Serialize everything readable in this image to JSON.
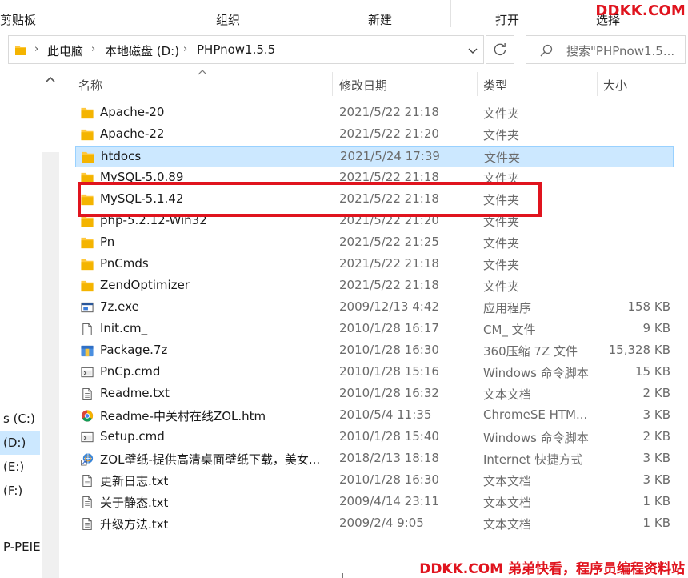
{
  "ribbon": {
    "groups": [
      "剪贴板",
      "组织",
      "新建",
      "打开",
      "选择"
    ]
  },
  "watermark_top": "DDKK.COM",
  "address": {
    "crumbs": [
      "此电脑",
      "本地磁盘 (D:)",
      "PHPnow1.5.5"
    ]
  },
  "search": {
    "placeholder": "搜索\"PHPnow1.5..."
  },
  "nav": {
    "items": [
      {
        "label": "s (C:)",
        "selected": false
      },
      {
        "label": "(D:)",
        "selected": true
      },
      {
        "label": "(E:)",
        "selected": false
      },
      {
        "label": "(F:)",
        "selected": false
      },
      {
        "label": "P-PEIEL",
        "selected": false
      }
    ]
  },
  "columns": {
    "name": "名称",
    "date": "修改日期",
    "type": "类型",
    "size": "大小"
  },
  "files": [
    {
      "icon": "folder-icon",
      "name": "Apache-20",
      "date": "2021/5/22 21:18",
      "type": "文件夹",
      "size": ""
    },
    {
      "icon": "folder-icon",
      "name": "Apache-22",
      "date": "2021/5/22 21:20",
      "type": "文件夹",
      "size": ""
    },
    {
      "icon": "folder-icon",
      "name": "htdocs",
      "date": "2021/5/24 17:39",
      "type": "文件夹",
      "size": "",
      "selected": true
    },
    {
      "icon": "folder-icon",
      "name": "MySQL-5.0.89",
      "date": "2021/5/22 21:18",
      "type": "文件夹",
      "size": ""
    },
    {
      "icon": "folder-icon",
      "name": "MySQL-5.1.42",
      "date": "2021/5/22 21:18",
      "type": "文件夹",
      "size": ""
    },
    {
      "icon": "folder-icon",
      "name": "php-5.2.12-Win32",
      "date": "2021/5/22 21:20",
      "type": "文件夹",
      "size": ""
    },
    {
      "icon": "folder-icon",
      "name": "Pn",
      "date": "2021/5/22 21:25",
      "type": "文件夹",
      "size": ""
    },
    {
      "icon": "folder-icon",
      "name": "PnCmds",
      "date": "2021/5/22 21:18",
      "type": "文件夹",
      "size": ""
    },
    {
      "icon": "folder-icon",
      "name": "ZendOptimizer",
      "date": "2021/5/22 21:18",
      "type": "文件夹",
      "size": ""
    },
    {
      "icon": "exe-icon",
      "name": "7z.exe",
      "date": "2009/12/13 4:42",
      "type": "应用程序",
      "size": "158 KB"
    },
    {
      "icon": "file-icon",
      "name": "Init.cm_",
      "date": "2010/1/28 16:17",
      "type": "CM_ 文件",
      "size": "9 KB"
    },
    {
      "icon": "archive-icon",
      "name": "Package.7z",
      "date": "2010/1/28 16:30",
      "type": "360压缩 7Z 文件",
      "size": "15,328 KB"
    },
    {
      "icon": "cmd-icon",
      "name": "PnCp.cmd",
      "date": "2010/1/28 15:16",
      "type": "Windows 命令脚本",
      "size": "15 KB"
    },
    {
      "icon": "text-file-icon",
      "name": "Readme.txt",
      "date": "2010/1/28 16:32",
      "type": "文本文档",
      "size": "2 KB"
    },
    {
      "icon": "chrome-icon",
      "name": "Readme-中关村在线ZOL.htm",
      "date": "2010/5/4 11:35",
      "type": "ChromeSE HTM...",
      "size": "3 KB"
    },
    {
      "icon": "cmd-icon",
      "name": "Setup.cmd",
      "date": "2010/1/28 15:40",
      "type": "Windows 命令脚本",
      "size": "2 KB"
    },
    {
      "icon": "internet-shortcut-icon",
      "name": "ZOL壁纸-提供高清桌面壁纸下载，美女...",
      "date": "2018/2/13 18:18",
      "type": "Internet 快捷方式",
      "size": "3 KB"
    },
    {
      "icon": "text-file-icon",
      "name": "更新日志.txt",
      "date": "2010/1/28 16:30",
      "type": "文本文档",
      "size": "3 KB"
    },
    {
      "icon": "text-file-icon",
      "name": "关于静态.txt",
      "date": "2009/4/14 23:11",
      "type": "文本文档",
      "size": "1 KB"
    },
    {
      "icon": "text-file-icon",
      "name": "升级方法.txt",
      "date": "2009/2/4 9:05",
      "type": "文本文档",
      "size": "1 KB"
    }
  ],
  "watermark_bottom": "DDKK.COM 弟弟快看，程序员编程资料站",
  "colors": {
    "selection": "#cce8ff",
    "annotation_red": "#e0141e",
    "folder_yellow": "#ffc83d"
  }
}
